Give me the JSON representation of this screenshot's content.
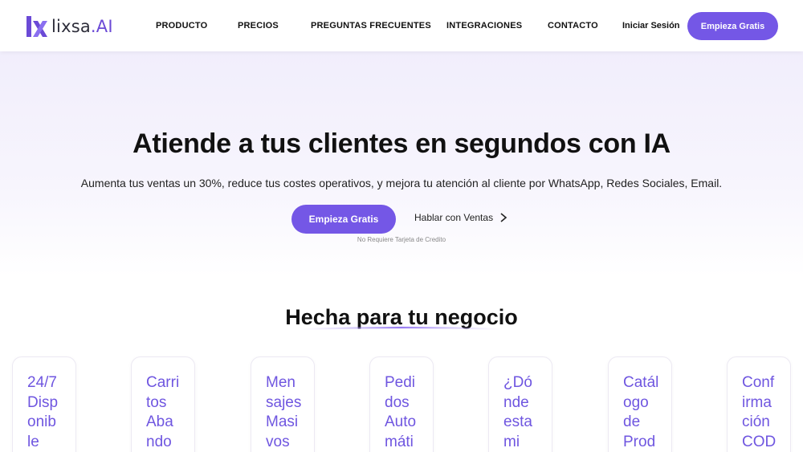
{
  "brand": {
    "name": "lixsa",
    "suffix": ".AI",
    "accent_color": "#7457e6"
  },
  "nav": {
    "links": [
      "PRODUCTO",
      "PRECIOS",
      "PREGUNTAS FRECUENTES",
      "INTEGRACIONES",
      "CONTACTO"
    ],
    "login_label": "Iniciar Sesión",
    "cta_label": "Empieza Gratis"
  },
  "hero": {
    "title": "Atiende a tus clientes en segundos con IA",
    "subtitle": "Aumenta tus ventas un 30%, reduce tus costes operativos, y mejora tu atención al cliente por WhatsApp, Redes Sociales, Email.",
    "cta_label": "Empieza Gratis",
    "secondary_label": "Hablar con Ventas",
    "secondary_icon": "chevron-right-icon",
    "note": "No Requiere Tarjeta de Credito"
  },
  "features": {
    "title": "Hecha para tu negocio",
    "cards": [
      {
        "lines": [
          "24/7",
          "Disp",
          "onib",
          "le"
        ]
      },
      {
        "lines": [
          "Carri",
          "tos",
          "Aba",
          "ndo"
        ]
      },
      {
        "lines": [
          "Men",
          "sajes",
          "Masi",
          "vos"
        ]
      },
      {
        "lines": [
          "Pedi",
          "dos",
          "Auto",
          "máti"
        ]
      },
      {
        "lines": [
          "¿Dó",
          "nde",
          "esta",
          "mi"
        ]
      },
      {
        "lines": [
          "Catál",
          "ogo",
          "de",
          "Prod"
        ]
      },
      {
        "lines": [
          "Conf",
          "irma",
          "ción",
          "COD"
        ]
      }
    ]
  }
}
